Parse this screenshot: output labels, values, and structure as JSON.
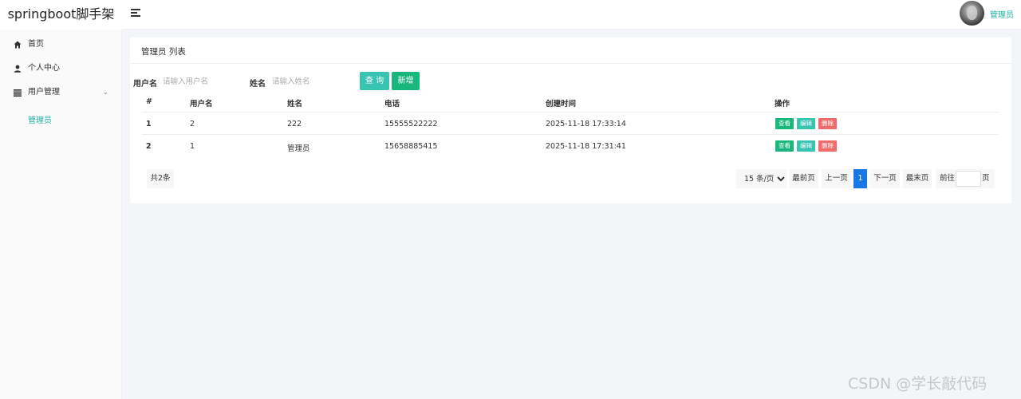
{
  "header": {
    "app_title": "springboot脚手架",
    "user_name": "管理员"
  },
  "sidebar": {
    "items": [
      {
        "label": "首页",
        "icon": "home-icon"
      },
      {
        "label": "个人中心",
        "icon": "user-icon"
      },
      {
        "label": "用户管理",
        "icon": "list-icon"
      }
    ],
    "sub_items": [
      {
        "label": "管理员"
      }
    ]
  },
  "panel": {
    "title": "管理员 列表"
  },
  "search": {
    "username_label": "用户名",
    "username_placeholder": "请输入用户名",
    "name_label": "姓名",
    "name_placeholder": "请输入姓名",
    "query_label": "查 询",
    "add_label": "新增"
  },
  "table": {
    "headers": [
      "#",
      "用户名",
      "姓名",
      "电话",
      "创建时间",
      "操作"
    ],
    "rows": [
      {
        "index": "1",
        "username": "2",
        "name": "222",
        "phone": "15555522222",
        "created": "2025-11-18 17:33:14"
      },
      {
        "index": "2",
        "username": "1",
        "name": "管理员",
        "phone": "15658885415",
        "created": "2025-11-18 17:31:41"
      }
    ],
    "actions": {
      "view": "查看",
      "edit": "编辑",
      "delete": "删除"
    }
  },
  "pagination": {
    "total_text": "共2条",
    "page_size": "15 条/页",
    "first": "最前页",
    "prev": "上一页",
    "current": "1",
    "next": "下一页",
    "last": "最末页",
    "goto_prefix": "前往",
    "goto_suffix": "页"
  },
  "watermark": "CSDN @学长敲代码",
  "colors": {
    "accent": "#20b2a4",
    "query_button": "#39c4b2",
    "add_button": "#19b77c",
    "delete_button": "#f06c6c",
    "active_page": "#1a78e6"
  }
}
